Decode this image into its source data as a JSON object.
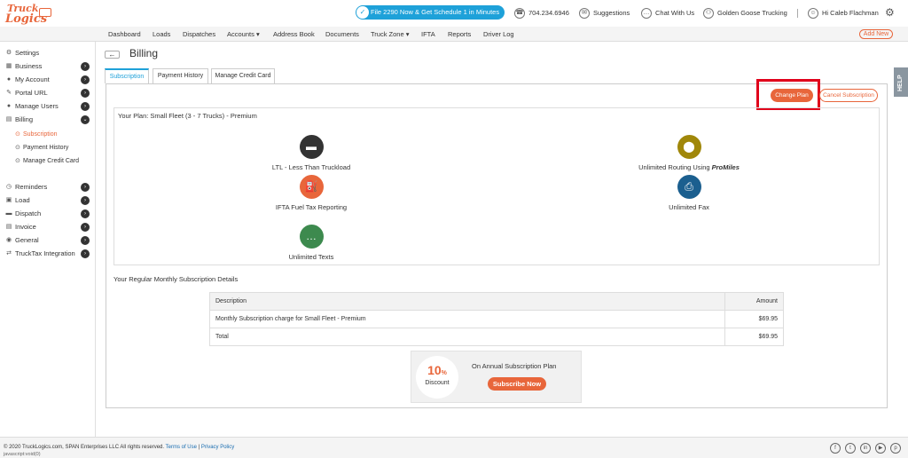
{
  "header": {
    "logo_line1": "Truck",
    "logo_line2": "Logics",
    "promo_text": "File 2290 Now & Get Schedule 1 in Minutes",
    "phone": "704.234.6946",
    "suggestions": "Suggestions",
    "chat": "Chat With Us",
    "company": "Golden Goose Trucking",
    "greeting": "Hi Caleb Flachman"
  },
  "nav": {
    "items": [
      "Dashboard",
      "Loads",
      "Dispatches",
      "Accounts",
      "Address Book",
      "Documents",
      "Truck Zone",
      "IFTA",
      "Reports",
      "Driver Log"
    ],
    "add_new": "Add New"
  },
  "sidebar": {
    "items": [
      {
        "label": "Settings",
        "icon": "gear-icon"
      },
      {
        "label": "Business",
        "icon": "building-icon"
      },
      {
        "label": "My Account",
        "icon": "user-icon"
      },
      {
        "label": "Portal URL",
        "icon": "link-icon"
      },
      {
        "label": "Manage Users",
        "icon": "users-icon"
      },
      {
        "label": "Billing",
        "icon": "billing-icon"
      }
    ],
    "sub_items": [
      {
        "label": "Subscription"
      },
      {
        "label": "Payment History"
      },
      {
        "label": "Manage Credit Card"
      }
    ],
    "lower_items": [
      {
        "label": "Reminders"
      },
      {
        "label": "Load"
      },
      {
        "label": "Dispatch"
      },
      {
        "label": "Invoice"
      },
      {
        "label": "General"
      },
      {
        "label": "TruckTax Integration"
      }
    ]
  },
  "page": {
    "title": "Billing",
    "tabs": [
      "Subscription",
      "Payment History",
      "Manage Credit Card"
    ],
    "change_plan": "Change Plan",
    "cancel_subscription": "Cancel Subscription",
    "plan_title": "Your Plan: Small Fleet (3 - 7 Trucks) - Premium",
    "features": [
      {
        "label": "LTL - Less Than Truckload",
        "color": "#333333",
        "icon": "truck-icon"
      },
      {
        "label": "Unlimited Routing Using ",
        "brand": "ProMiles",
        "color": "#a0870a",
        "icon": "location-pin-icon"
      },
      {
        "label": "IFTA Fuel Tax Reporting",
        "color": "#e8663b",
        "icon": "fuel-pump-icon"
      },
      {
        "label": "Unlimited Fax",
        "color": "#1b5f8f",
        "icon": "fax-icon"
      },
      {
        "label": "Unlimited Texts",
        "color": "#3d8a4e",
        "icon": "chat-bubble-icon"
      }
    ],
    "monthly_title": "Your Regular Monthly Subscription Details",
    "table": {
      "headers": [
        "Description",
        "Amount"
      ],
      "rows": [
        [
          "Monthly Subscription charge for Small Fleet - Premium",
          "$69.95"
        ]
      ],
      "total_label": "Total",
      "total_value": "$69.95"
    },
    "promo": {
      "discount": "10",
      "discount_unit": "%",
      "discount_label": "Discount",
      "text": "On Annual Subscription Plan",
      "button": "Subscribe Now"
    },
    "help": "HELP"
  },
  "footer": {
    "copyright": "© 2020 TruckLogics.com, SPAN Enterprises LLC All rights reserved.",
    "terms": "Terms of Use",
    "separator": "|",
    "privacy": "Privacy Policy",
    "status": "javascript:void(0)"
  },
  "colors": {
    "accent": "#e8663b",
    "promo_blue": "#1ea1d9",
    "highlight": "#e0001b"
  }
}
